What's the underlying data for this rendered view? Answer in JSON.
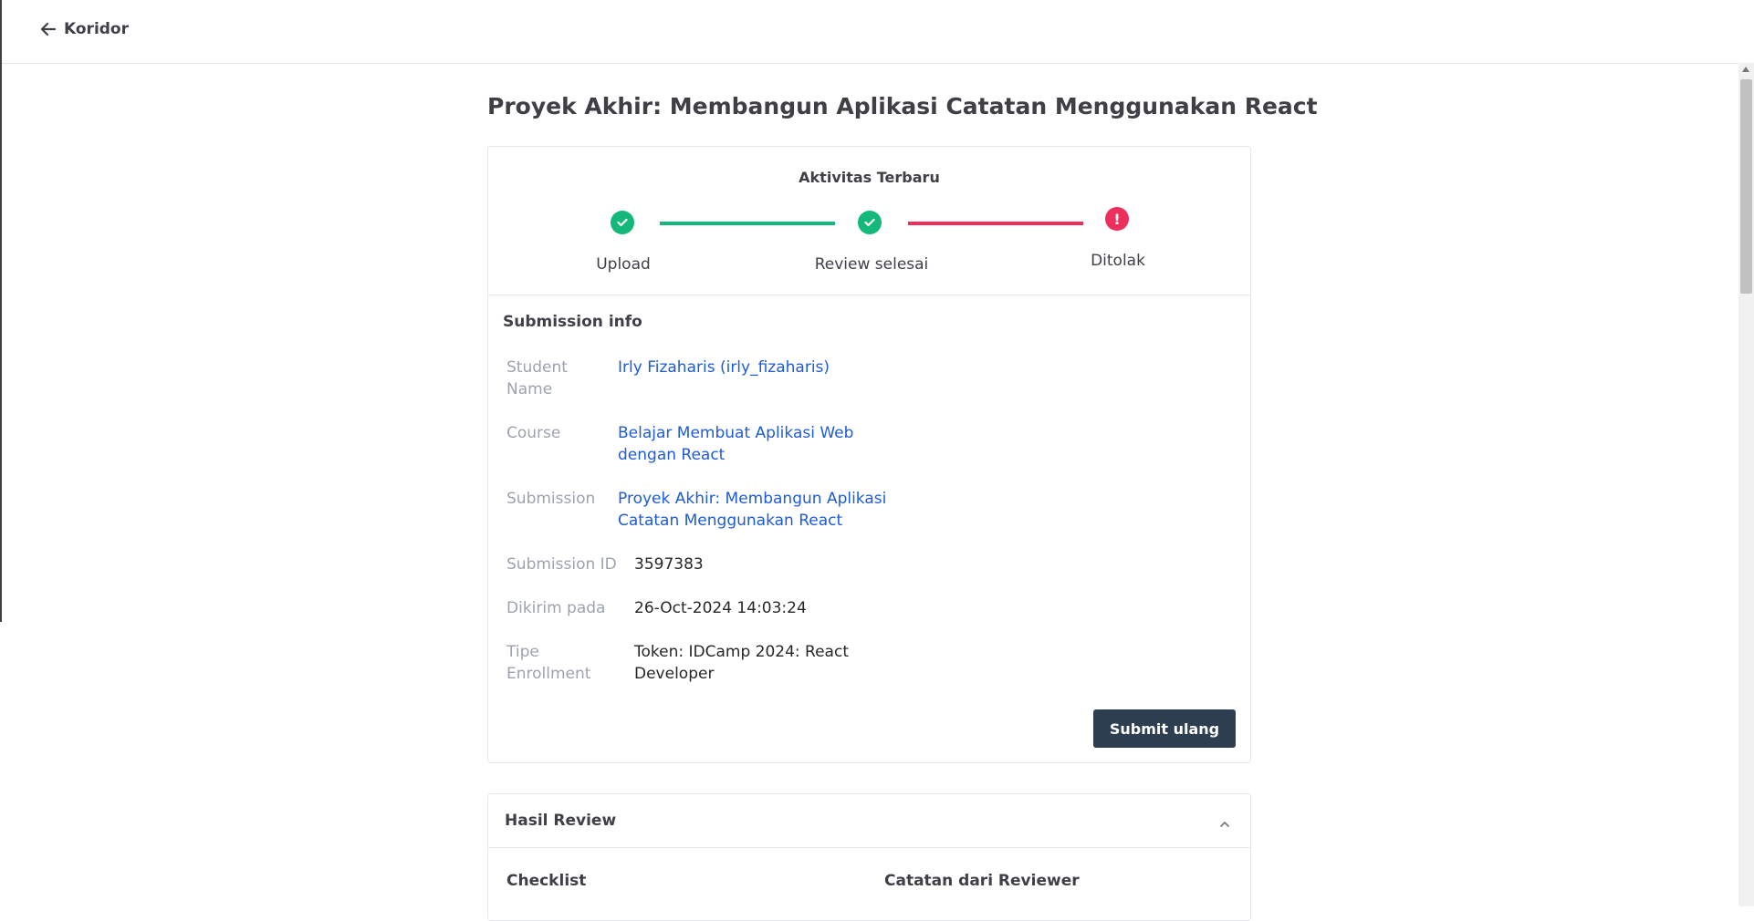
{
  "nav": {
    "back_label": "Koridor"
  },
  "page": {
    "title": "Proyek Akhir: Membangun Aplikasi Catatan Menggunakan React"
  },
  "activity": {
    "title": "Aktivitas Terbaru",
    "steps": [
      {
        "label": "Upload",
        "status": "done"
      },
      {
        "label": "Review selesai",
        "status": "done"
      },
      {
        "label": "Ditolak",
        "status": "rejected"
      }
    ],
    "colors": {
      "done": "#14b87a",
      "rejected": "#ee2f5b"
    },
    "rejected_icon": "!"
  },
  "submission_info": {
    "title": "Submission info",
    "student_name": {
      "label_1": "Student",
      "label_2": "Name",
      "value": "Irly Fizaharis (irly_fizaharis)"
    },
    "course": {
      "label": "Course",
      "value_1": "Belajar Membuat Aplikasi Web",
      "value_2": "dengan React"
    },
    "submission": {
      "label": "Submission",
      "value_1": "Proyek Akhir: Membangun Aplikasi",
      "value_2": "Catatan Menggunakan React"
    },
    "submission_id": {
      "label": "Submission ID",
      "value": "3597383"
    },
    "sent_at": {
      "label": "Dikirim pada",
      "value": "26-Oct-2024 14:03:24"
    },
    "enrollment": {
      "label_1": "Tipe",
      "label_2": "Enrollment",
      "value_1": "Token: IDCamp 2024: React",
      "value_2": "Developer"
    },
    "resubmit_label": "Submit ulang"
  },
  "review": {
    "title": "Hasil Review",
    "checklist_label": "Checklist",
    "reviewer_notes_label": "Catatan dari Reviewer"
  },
  "icons": {
    "back": "arrow-left-icon",
    "check": "check-icon",
    "alert": "exclamation-icon",
    "collapse": "chevron-up-icon"
  },
  "colors": {
    "link": "#1e5bd6",
    "button": "#2d3e50"
  }
}
